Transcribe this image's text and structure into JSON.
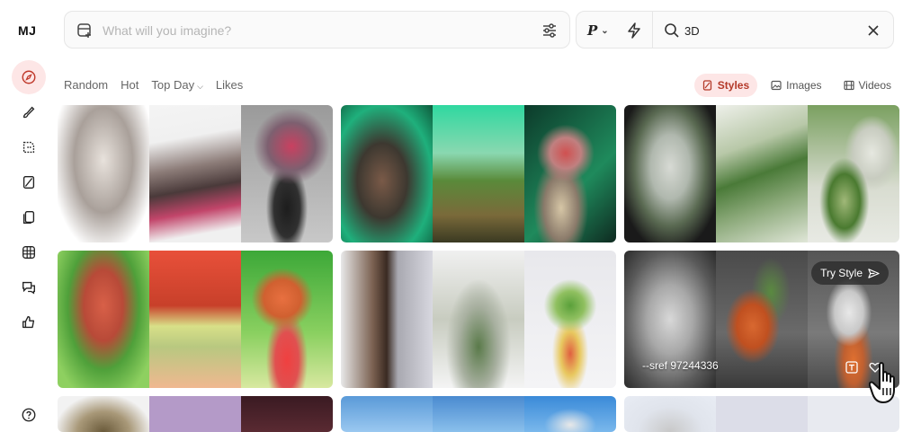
{
  "app": {
    "logo": "MJ"
  },
  "sidebar": {
    "items": [
      {
        "name": "explore",
        "icon": "compass-icon",
        "active": true
      },
      {
        "name": "create",
        "icon": "paintbrush-icon",
        "active": false
      },
      {
        "name": "edit",
        "icon": "sticker-icon",
        "active": false
      },
      {
        "name": "personalize",
        "icon": "palette-icon",
        "active": false
      },
      {
        "name": "organize",
        "icon": "copy-icon",
        "active": false
      },
      {
        "name": "rooms",
        "icon": "grid-icon",
        "active": false
      },
      {
        "name": "chat",
        "icon": "chat-bubbles-icon",
        "active": false
      },
      {
        "name": "rate",
        "icon": "thumbs-up-icon",
        "active": false
      },
      {
        "name": "help",
        "icon": "help-icon",
        "active": false
      }
    ]
  },
  "prompt": {
    "placeholder": "What will you imagine?",
    "value": ""
  },
  "controls": {
    "p_label": "P",
    "search_value": "3D"
  },
  "filters": {
    "random": "Random",
    "hot": "Hot",
    "top_day": "Top Day",
    "likes": "Likes"
  },
  "view_tabs": {
    "styles": "Styles",
    "images": "Images",
    "videos": "Videos",
    "active": "styles"
  },
  "cards": {
    "hover": {
      "try_style": "Try Style",
      "sref": "--sref 97244336"
    }
  },
  "colors": {
    "accent": "#b43a2a",
    "accent_bg": "#fde6e6"
  }
}
